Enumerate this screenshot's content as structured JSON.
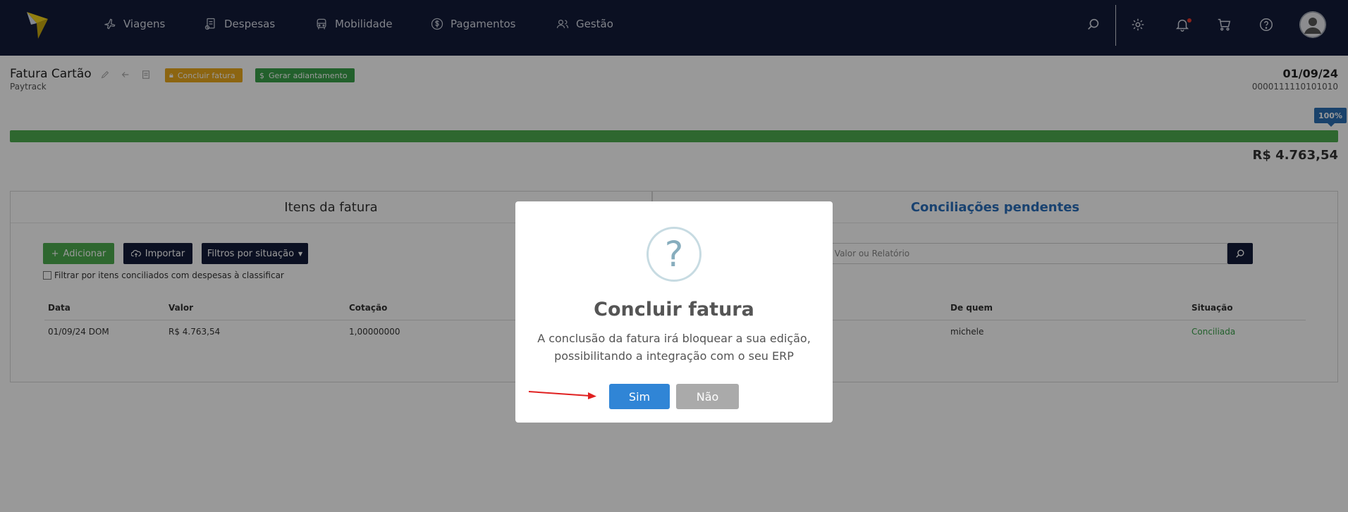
{
  "nav": {
    "items": [
      {
        "label": "Viagens",
        "icon": "plane-icon"
      },
      {
        "label": "Despesas",
        "icon": "receipt-icon"
      },
      {
        "label": "Mobilidade",
        "icon": "car-icon"
      },
      {
        "label": "Pagamentos",
        "icon": "dollar-icon"
      },
      {
        "label": "Gestão",
        "icon": "users-icon"
      }
    ],
    "right_icons": [
      "search-icon",
      "gear-icon",
      "bell-icon",
      "cart-icon",
      "help-icon",
      "user-avatar-icon"
    ]
  },
  "page": {
    "title": "Fatura Cartão",
    "subtitle": "Paytrack",
    "concluir_label": "Concluir fatura",
    "adiantamento_label": "Gerar adiantamento",
    "date": "01/09/24",
    "code": "0000111110101010"
  },
  "progress": {
    "percent_label": "100%",
    "fraction": 1.0,
    "total": "R$ 4.763,54"
  },
  "left_panel": {
    "title": "Itens da fatura",
    "add_label": "Adicionar",
    "import_label": "Importar",
    "filter_label": "Filtros por situação",
    "checkbox_label": "Filtrar por itens conciliados com despesas à classificar",
    "columns": [
      "Data",
      "Valor",
      "Cotação"
    ],
    "row": {
      "data": "01/09/24 DOM",
      "valor": "R$ 4.763,54",
      "cotacao": "1,00000000"
    }
  },
  "right_panel": {
    "title": "Conciliações pendentes",
    "search_placeholder": "crição, Valor ou Relatório",
    "columns": [
      "De quem",
      "Situação"
    ],
    "row": {
      "de_quem": "michele",
      "situacao": "Conciliada"
    }
  },
  "modal": {
    "icon": "?",
    "title": "Concluir fatura",
    "text": "A conclusão da fatura irá bloquear a sua edição, possibilitando a integração com o seu ERP",
    "confirm_label": "Sim",
    "cancel_label": "Não"
  },
  "colors": {
    "navbar": "#131c3a",
    "progress": "#4dac4f",
    "confirm": "#3085d6",
    "cancel": "#aaaaaa",
    "accent_blue": "#2a6fbb",
    "arrow": "#e02020"
  }
}
